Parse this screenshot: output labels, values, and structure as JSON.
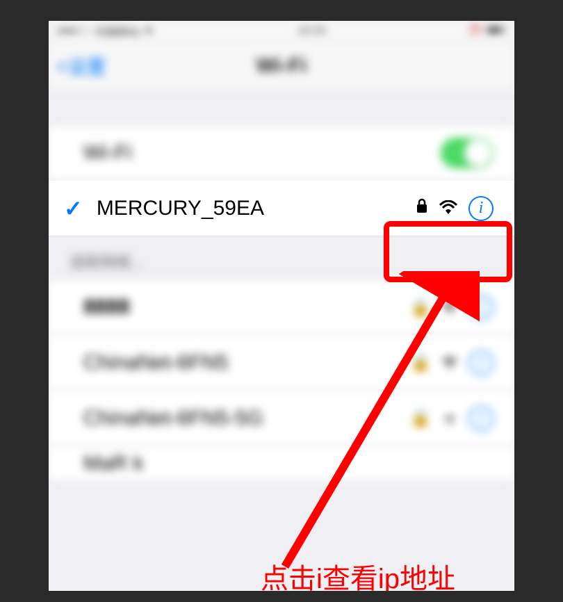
{
  "statusbar": {
    "carrier": "中国移动",
    "time": "10:34"
  },
  "nav": {
    "back_label": "设置",
    "title": "Wi-Fi"
  },
  "wifi_toggle": {
    "label": "Wi-Fi",
    "on": true
  },
  "connected": {
    "name": "MERCURY_59EA"
  },
  "section": {
    "header": "选取网络..."
  },
  "networks": [
    {
      "name": "8888"
    },
    {
      "name": "ChinaNet-6FN5"
    },
    {
      "name": "ChinaNet-6FN5-5G"
    },
    {
      "name": "MaR k"
    }
  ],
  "annotation": {
    "text": "点击i查看ip地址"
  }
}
